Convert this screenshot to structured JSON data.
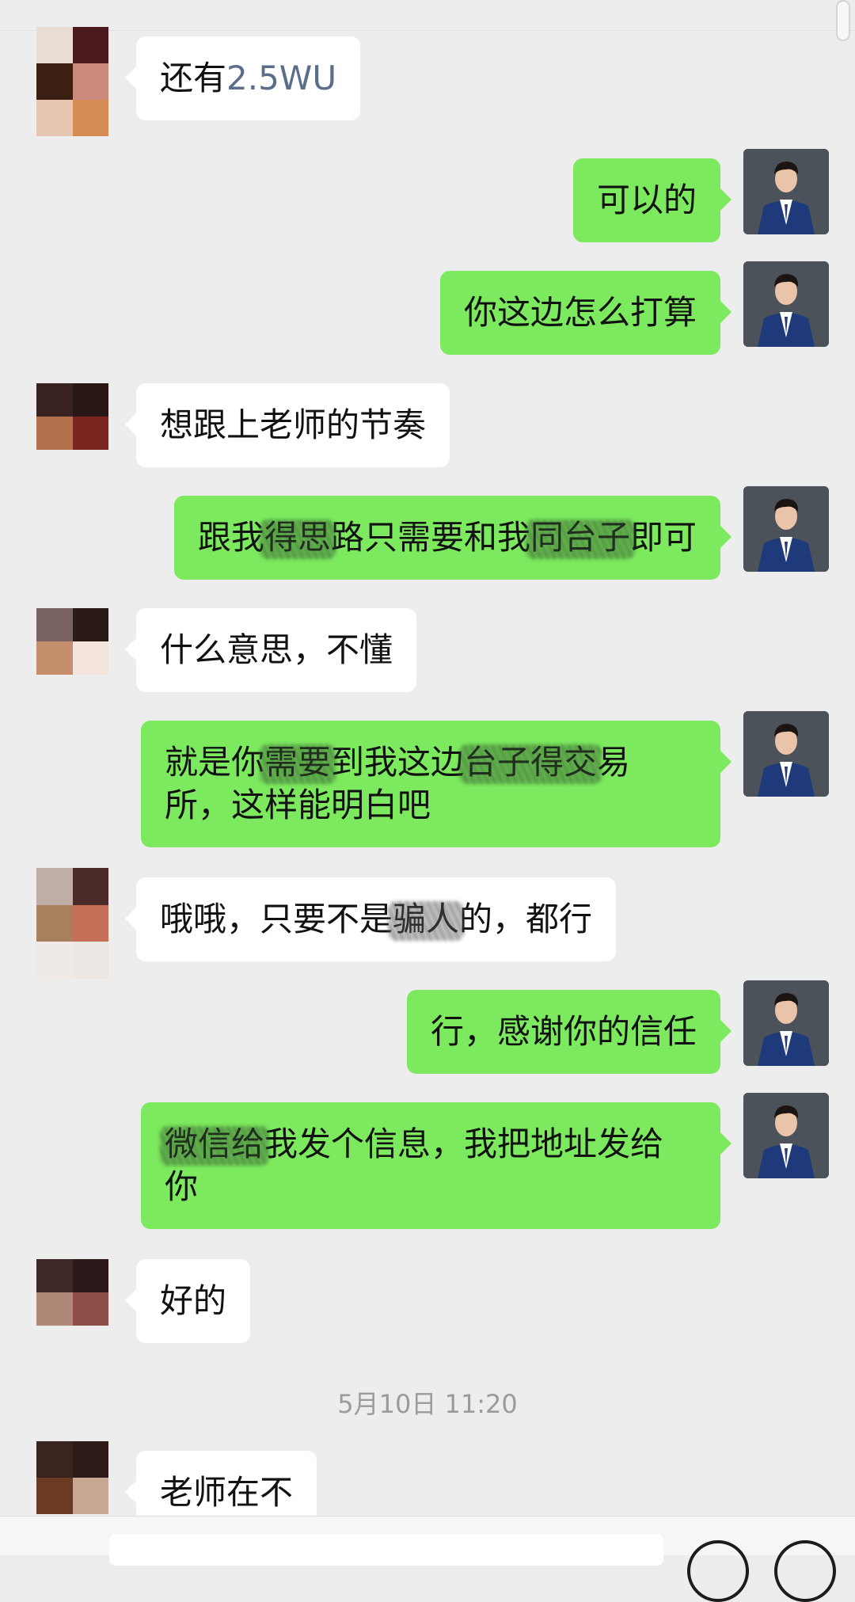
{
  "chat": {
    "messages": [
      {
        "side": "in",
        "text": "还有2.5WU"
      },
      {
        "side": "out",
        "text": "可以的"
      },
      {
        "side": "out",
        "text": "你这边怎么打算"
      },
      {
        "side": "in",
        "text": "想跟上老师的节奏"
      },
      {
        "side": "out",
        "text": "跟我得思路只需要和我同台子即可"
      },
      {
        "side": "in",
        "text": "什么意思，不懂"
      },
      {
        "side": "out",
        "text": "就是你需要到我这边台子得交易所，这样能明白吧"
      },
      {
        "side": "in",
        "text": "哦哦，只要不是骗人的，都行"
      },
      {
        "side": "out",
        "text": "行，感谢你的信任"
      },
      {
        "side": "out",
        "text": "微信给我发个信息，我把地址发给你"
      },
      {
        "side": "in",
        "text": "好的"
      },
      {
        "side": "in",
        "text": "老师在不"
      }
    ],
    "timestamp": "5月10日 11:20"
  },
  "colors": {
    "background": "#ededed",
    "incoming_bubble": "#ffffff",
    "outgoing_bubble": "#7ce95e",
    "timestamp": "#9b9b9b"
  }
}
